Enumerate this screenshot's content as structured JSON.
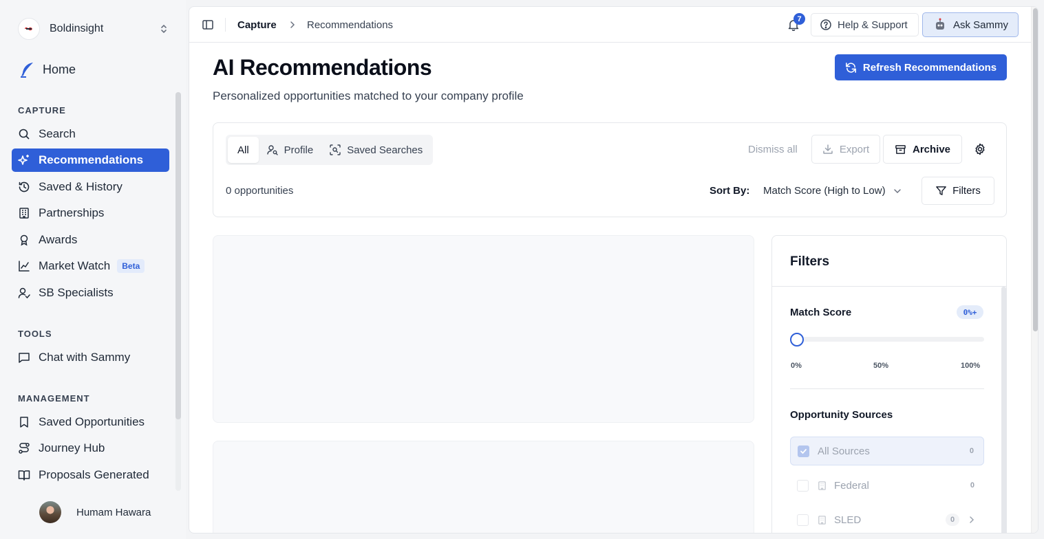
{
  "workspace": {
    "name": "Boldinsight"
  },
  "sidebar": {
    "home_label": "Home",
    "capture_section": "CAPTURE",
    "capture_items": [
      {
        "label": "Search",
        "icon": "search-icon"
      },
      {
        "label": "Recommendations",
        "icon": "sparkles-icon",
        "active": true
      },
      {
        "label": "Saved & History",
        "icon": "history-icon"
      },
      {
        "label": "Partnerships",
        "icon": "building-icon"
      },
      {
        "label": "Awards",
        "icon": "award-icon"
      },
      {
        "label": "Market Watch",
        "icon": "chart-line-icon",
        "badge": "Beta"
      },
      {
        "label": "SB Specialists",
        "icon": "user-check-icon"
      }
    ],
    "tools_section": "TOOLS",
    "tools_items": [
      {
        "label": "Chat with Sammy",
        "icon": "chat-icon"
      }
    ],
    "management_section": "MANAGEMENT",
    "management_items": [
      {
        "label": "Saved Opportunities",
        "icon": "bookmark-icon"
      },
      {
        "label": "Journey Hub",
        "icon": "route-icon"
      },
      {
        "label": "Proposals Generated",
        "icon": "book-open-icon"
      }
    ],
    "user": {
      "name": "Humam Hawara"
    }
  },
  "topbar": {
    "breadcrumb": [
      "Capture",
      "Recommendations"
    ],
    "notification_count": "7",
    "help_label": "Help & Support",
    "ask_label": "Ask Sammy"
  },
  "page": {
    "title": "AI Recommendations",
    "subtitle": "Personalized opportunities matched to your company profile",
    "refresh_label": "Refresh Recommendations"
  },
  "toolbar": {
    "tabs": [
      {
        "label": "All",
        "active": true
      },
      {
        "label": "Profile",
        "icon": "user-search-icon"
      },
      {
        "label": "Saved Searches",
        "icon": "scan-search-icon"
      }
    ],
    "dismiss_label": "Dismiss all",
    "export_label": "Export",
    "archive_label": "Archive",
    "opportunity_count": "0 opportunities",
    "sort_label": "Sort By:",
    "sort_value": "Match Score (High to Low)",
    "filters_label": "Filters"
  },
  "filters_panel": {
    "title": "Filters",
    "match_score_label": "Match Score",
    "match_score_badge": "0%+",
    "match_score_value": 0,
    "ticks": [
      "0%",
      "50%",
      "100%"
    ],
    "sources_label": "Opportunity Sources",
    "sources": [
      {
        "label": "All Sources",
        "count": "0",
        "checked": true
      },
      {
        "label": "Federal",
        "count": "0",
        "checked": false
      },
      {
        "label": "SLED",
        "count": "0",
        "checked": false
      }
    ]
  },
  "colors": {
    "accent": "#2f5fd8",
    "accent_light": "#e4ecfa"
  }
}
